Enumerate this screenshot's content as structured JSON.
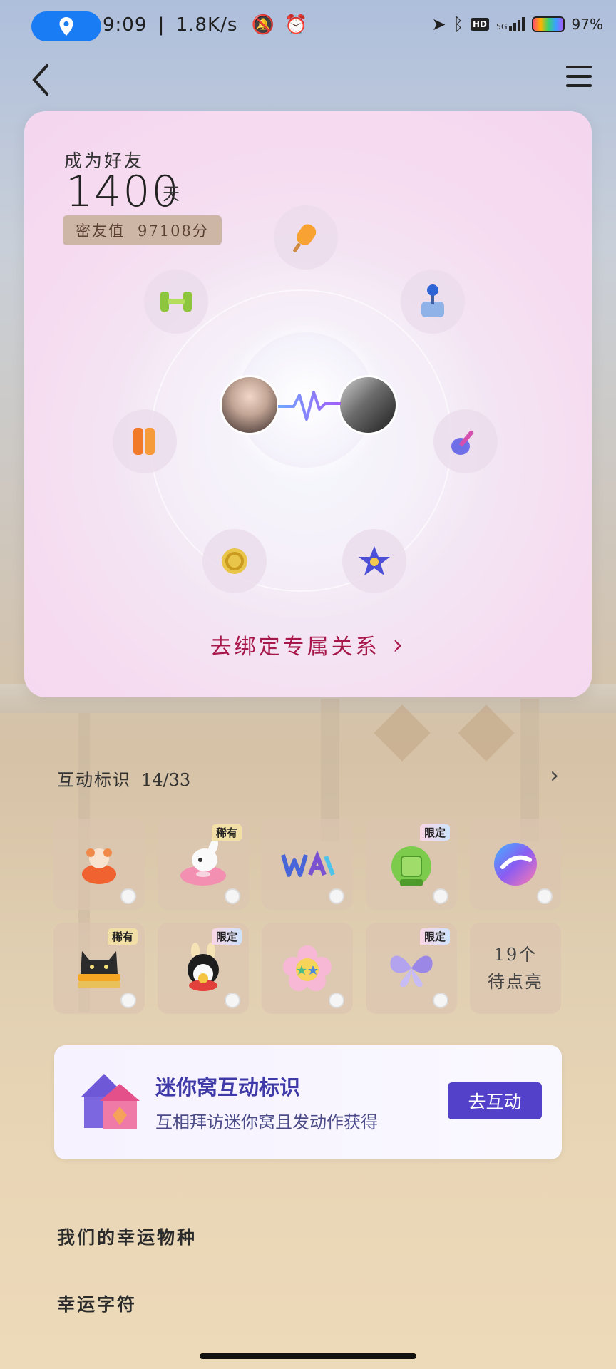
{
  "status_bar": {
    "time": "9:09",
    "speed": "1.8K/s",
    "network": "5G",
    "hd": "HD",
    "battery": "97%"
  },
  "card": {
    "became_friends_label": "成为好友",
    "days": "1400",
    "days_unit": "天",
    "intimacy_label": "密友值",
    "intimacy_value": "97108分",
    "bind_text": "去绑定专属关系",
    "bind_arrow": "›"
  },
  "interaction": {
    "title": "互动标识",
    "count": "14/33",
    "arrow": "›",
    "tiles": [
      {
        "icon": "monkey-on-fish-icon",
        "tag": ""
      },
      {
        "icon": "dog-donut-icon",
        "tag": "稀有"
      },
      {
        "icon": "wa-text-icon",
        "tag": ""
      },
      {
        "icon": "mooncake-icon",
        "tag": "限定"
      },
      {
        "icon": "planet-swirl-icon",
        "tag": ""
      },
      {
        "icon": "black-cat-sandwich-icon",
        "tag": "稀有"
      },
      {
        "icon": "penguin-bunny-icon",
        "tag": "限定"
      },
      {
        "icon": "flower-stars-icon",
        "tag": ""
      },
      {
        "icon": "butterfly-icon",
        "tag": "限定"
      }
    ],
    "pending_count": "19个",
    "pending_label": "待点亮"
  },
  "nest": {
    "title": "迷你窝互动标识",
    "subtitle": "互相拜访迷你窝且发动作获得",
    "button": "去互动"
  },
  "lucky": {
    "species": "我们的幸运物种",
    "characters": "幸运字符"
  },
  "colors": {
    "accent": "#5341c9",
    "bind_text": "#a8174a",
    "location_pill": "#1a7cf5"
  }
}
